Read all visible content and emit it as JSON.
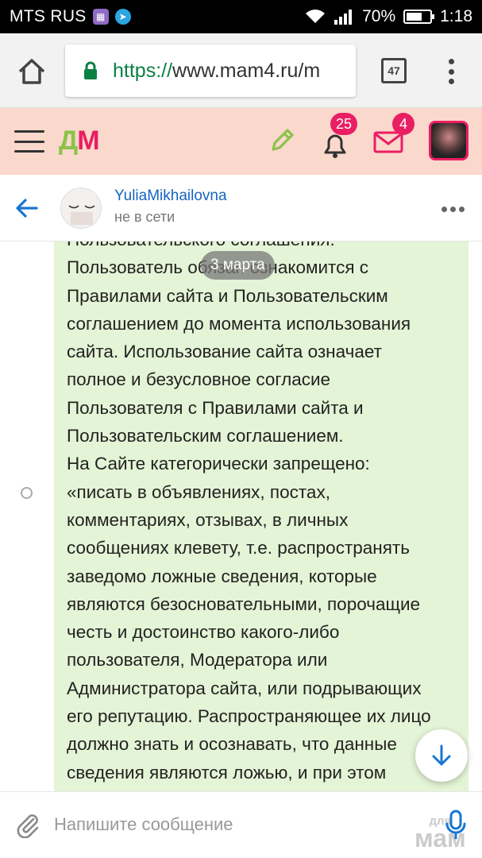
{
  "status_bar": {
    "carrier": "MTS RUS",
    "battery": "70%",
    "battery_level": 0.7,
    "time": "1:18"
  },
  "browser": {
    "url_scheme": "https://",
    "url_rest": "www.mam4.ru/m",
    "tab_count": "47"
  },
  "site_header": {
    "logo_d": "Д",
    "logo_m": "М",
    "notifications_count": "25",
    "messages_count": "4",
    "accent_color": "#e91e63",
    "header_bg": "#fbd8cc"
  },
  "chat_header": {
    "user_name": "YuliaMikhailovna",
    "user_status": "не в сети"
  },
  "conversation": {
    "date_label": "3 марта",
    "message_lines": [
      "Пользовательского соглашения.",
      " Пользователь обязан ознакомится с",
      "Правилами сайта и Пользовательским",
      "соглашением до момента использования",
      "сайта. Использование сайта означает",
      "полное и безусловное согласие",
      "Пользователя с Правилами сайта и",
      "Пользовательским соглашением.",
      "На Сайте категорически запрещено:",
      " «писать в объявлениях, постах,",
      "комментариях, отзывах, в личных",
      "сообщениях клевету, т.е. распространять",
      "заведомо ложные сведения, которые",
      "являются безосновательными, порочащие",
      "честь и достоинство какого-либо",
      "пользователя, Модератора или",
      "Администратора сайта, или подрывающих",
      "его репутацию. Распространяющее их лицо",
      "должно знать и осознавать, что данные",
      "сведения являются ложью, и при этом"
    ],
    "bubble_color": "#e4f4d6"
  },
  "composer": {
    "placeholder": "Напишите сообщение",
    "watermark_top": "для",
    "watermark_bottom": "мам"
  }
}
